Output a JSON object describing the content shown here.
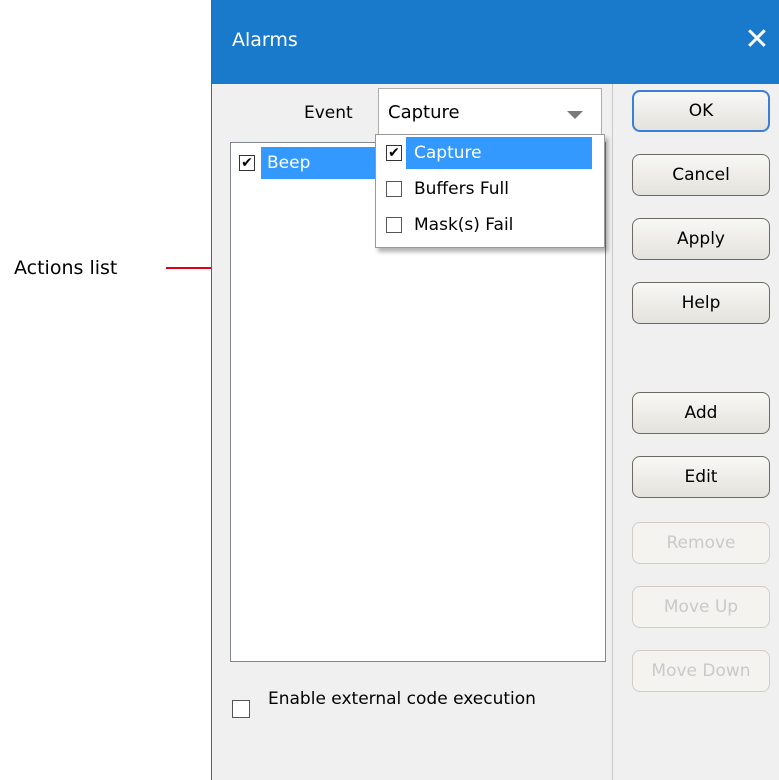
{
  "annotation": {
    "label": "Actions list"
  },
  "dialog": {
    "title": "Alarms",
    "close_glyph": "✕",
    "event_label": "Event",
    "event_selected": "Capture",
    "event_options": [
      "Capture",
      "Buffers Full",
      "Mask(s) Fail"
    ],
    "actions": [
      {
        "label": "Beep",
        "checked": true
      }
    ],
    "buttons": {
      "ok": "OK",
      "cancel": "Cancel",
      "apply": "Apply",
      "help": "Help",
      "add": "Add",
      "edit": "Edit",
      "remove": "Remove",
      "move_up": "Move Up",
      "move_down": "Move Down"
    },
    "disabled_buttons": [
      "Remove",
      "Move Up",
      "Move Down"
    ],
    "enable_external_label": "Enable external code execution",
    "enable_external_checked": false,
    "check_glyph": "✔"
  },
  "colors": {
    "titlebar": "#1979ca",
    "selection": "#3399ff",
    "callout": "#e0001a"
  }
}
